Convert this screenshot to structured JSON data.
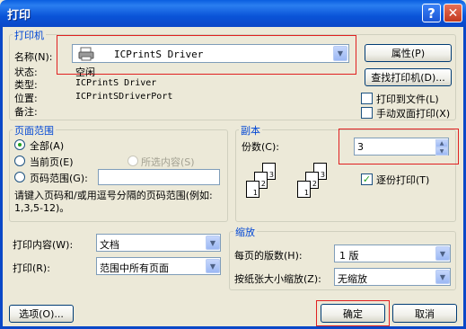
{
  "window": {
    "title": "打印",
    "help_glyph": "?",
    "close_glyph": "✕"
  },
  "printer": {
    "legend": "打印机",
    "name_label": "名称(N):",
    "name_value": "ICPrintS Driver",
    "status_label": "状态:",
    "status_value": "空闲",
    "type_label": "类型:",
    "type_value": "ICPrintS Driver",
    "where_label": "位置:",
    "where_value": "ICPrintSDriverPort",
    "comment_label": "备注:",
    "properties_button": "属性(P)",
    "find_button": "查找打印机(D)...",
    "print_to_file": "打印到文件(L)",
    "manual_duplex": "手动双面打印(X)"
  },
  "range": {
    "legend": "页面范围",
    "all": "全部(A)",
    "current": "当前页(E)",
    "selection": "所选内容(S)",
    "pages": "页码范围(G):",
    "pages_value": "",
    "hint": "请键入页码和/或用逗号分隔的页码范围(例如: 1,3,5-12)。"
  },
  "copies": {
    "legend": "副本",
    "count_label": "份数(C):",
    "count_value": "3",
    "collate": "逐份打印(T)",
    "collate_checked": true,
    "stack1": [
      "3",
      "2",
      "1"
    ],
    "stack2": [
      "3",
      "2",
      "1"
    ]
  },
  "print_what": {
    "label": "打印内容(W):",
    "value": "文档"
  },
  "print_range": {
    "label": "打印(R):",
    "value": "范围中所有页面"
  },
  "zoom": {
    "legend": "缩放",
    "pages_per_sheet_label": "每页的版数(H):",
    "pages_per_sheet_value": "1 版",
    "scale_label": "按纸张大小缩放(Z):",
    "scale_value": "无缩放"
  },
  "footer": {
    "options": "选项(O)...",
    "ok": "确定",
    "cancel": "取消"
  },
  "icons": {
    "printer": "printer-icon",
    "dropdown": "chevron-down-icon"
  },
  "colors": {
    "highlight": "#e02020",
    "title_bar": "#0a54d8",
    "group_label": "#0046d5"
  }
}
